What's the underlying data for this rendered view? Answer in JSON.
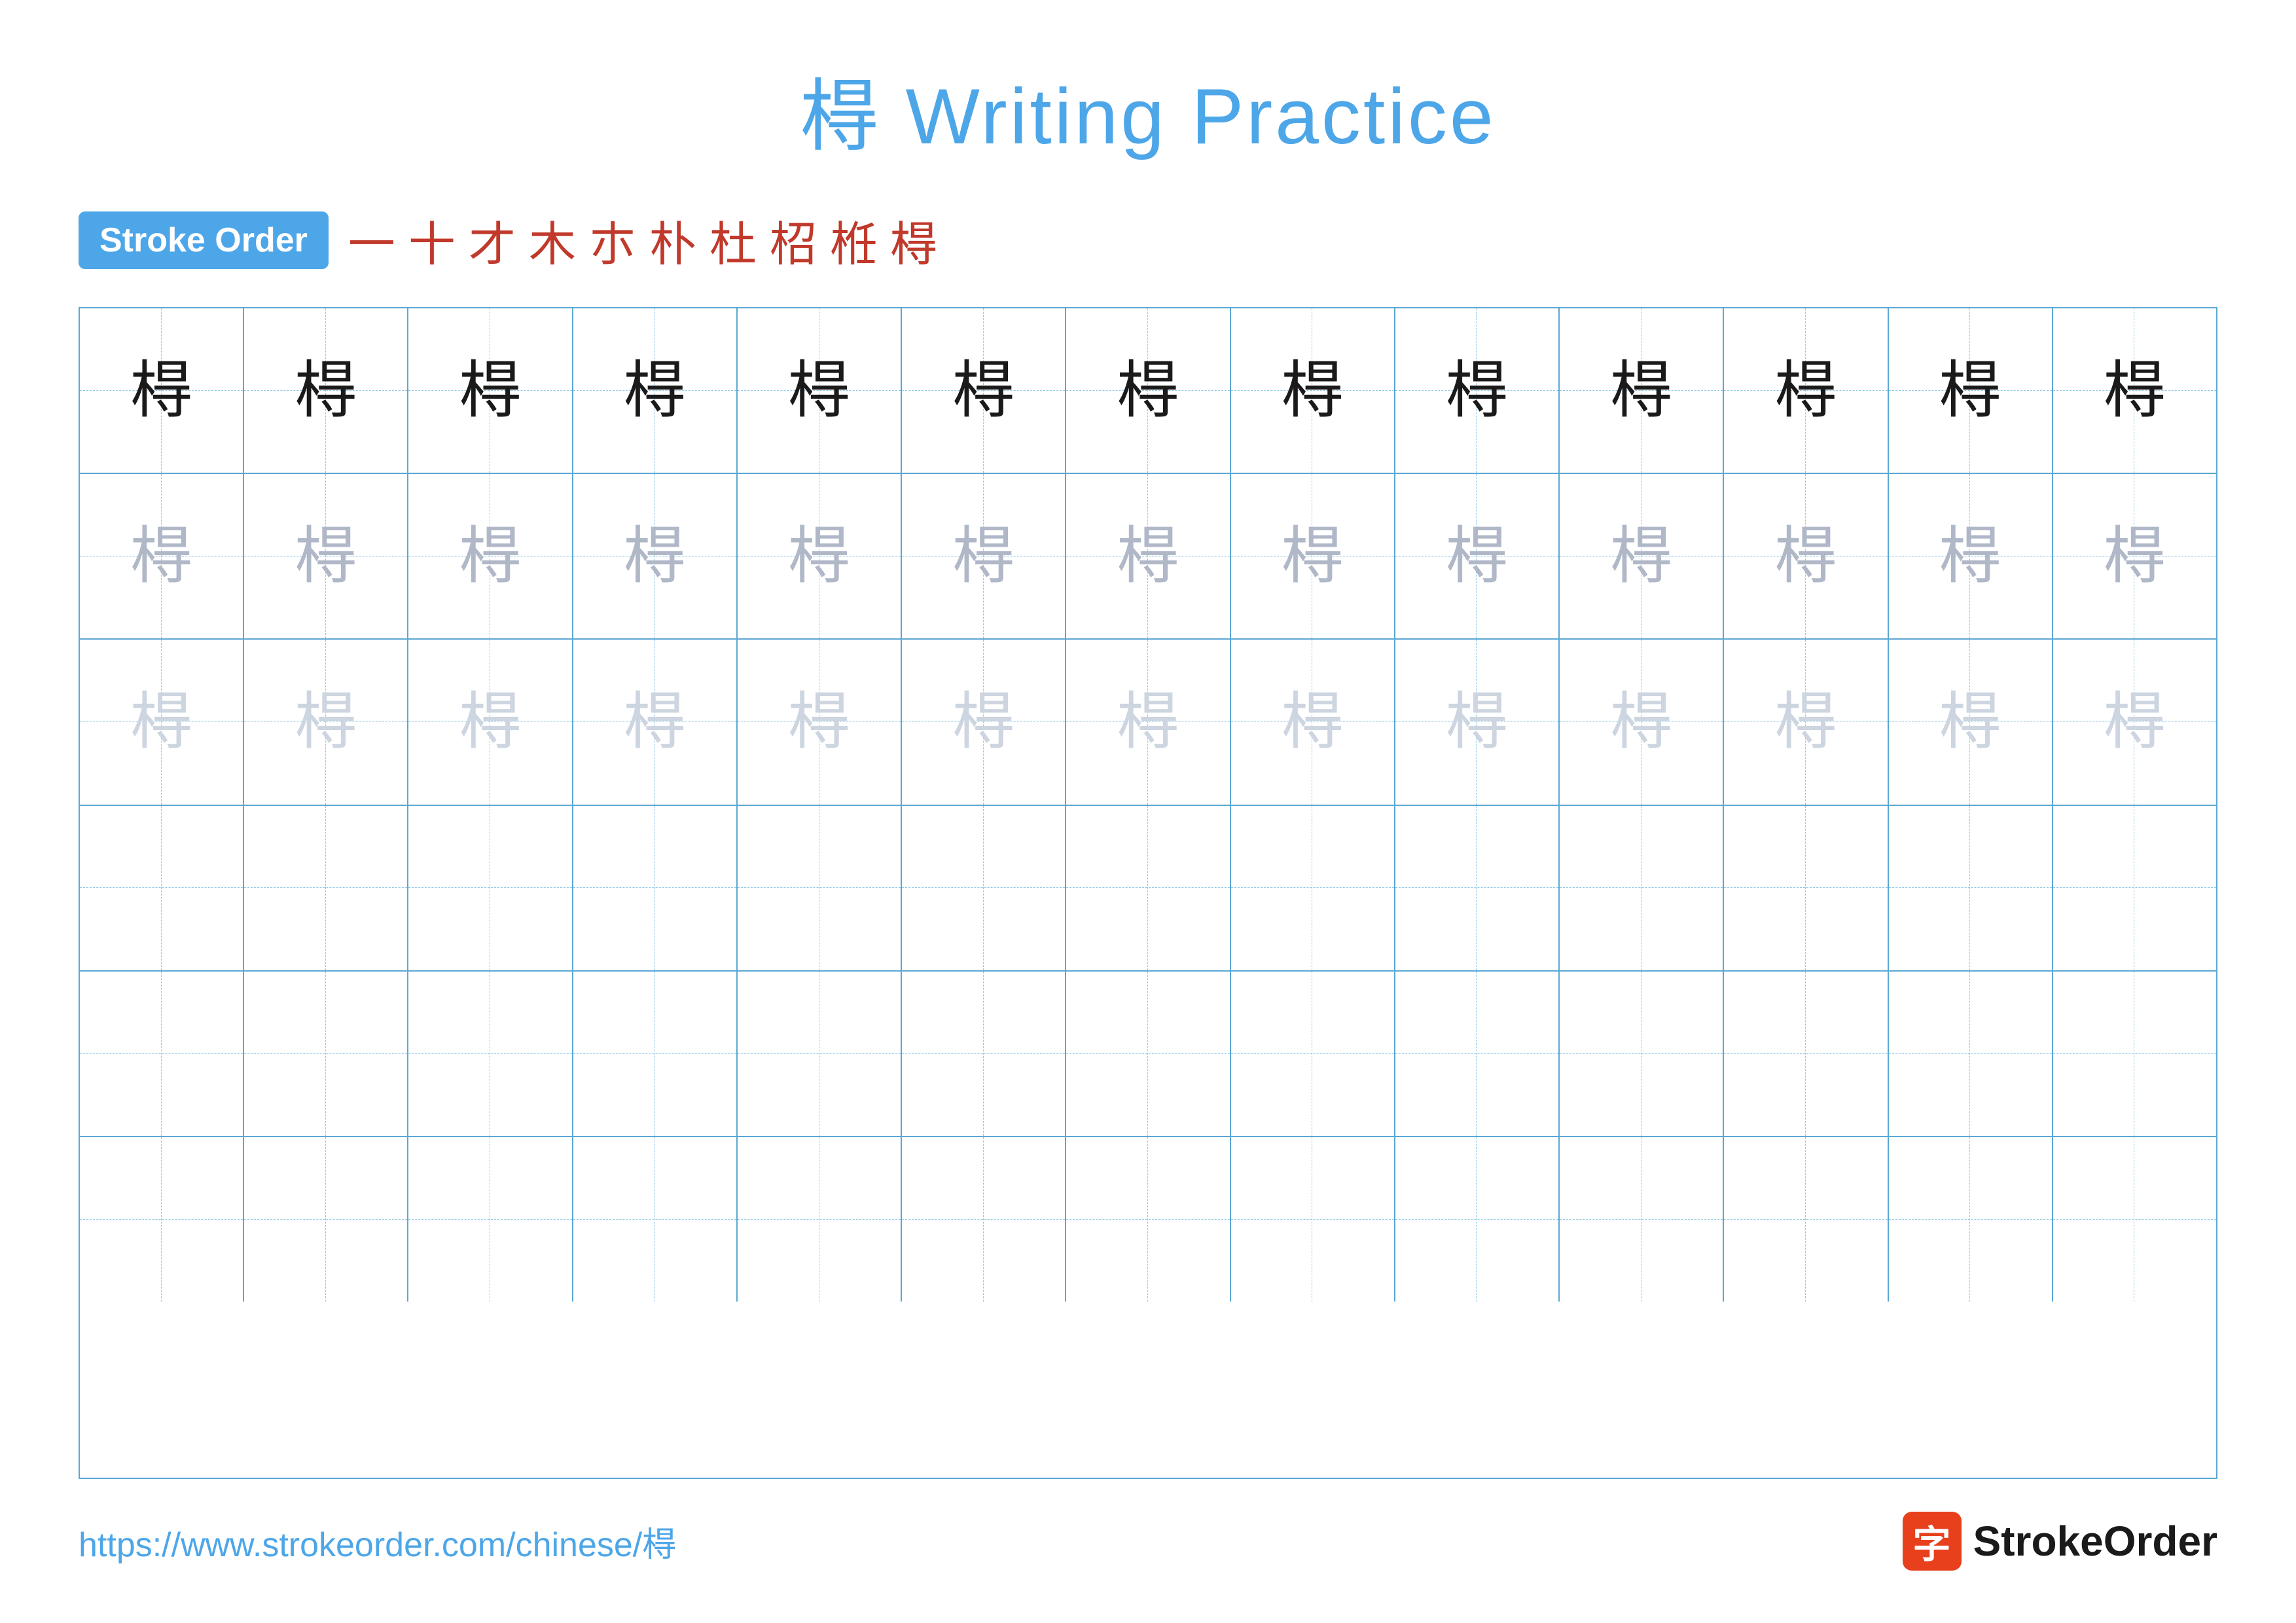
{
  "title": {
    "chinese_char": "棏",
    "text": "Writing Practice",
    "full": "棏 Writing Practice"
  },
  "stroke_order": {
    "badge_label": "Stroke Order",
    "steps": [
      "一",
      "十",
      "才",
      "木",
      "朩",
      "朴",
      "杜",
      "柖",
      "栣",
      "棏"
    ]
  },
  "grid": {
    "rows": 6,
    "cols": 13,
    "char": "棏",
    "row_styles": [
      "dark",
      "medium",
      "light",
      "empty",
      "empty",
      "empty"
    ]
  },
  "footer": {
    "url": "https://www.strokeorder.com/chinese/棏",
    "logo_icon": "字",
    "logo_text": "StrokeOrder"
  }
}
